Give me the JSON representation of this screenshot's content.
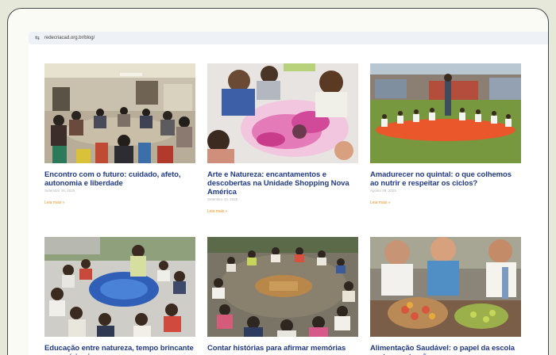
{
  "browser": {
    "url": "redecriacad.org.br/blog/",
    "url_icon": "tune-icon"
  },
  "posts": [
    {
      "title": "Encontro com o futuro: cuidado, afeto, autonomia e liberdade",
      "date": "Setembro 18, 2025",
      "read_more": "Leia mais »",
      "image": "group-meeting-photo"
    },
    {
      "title": "Arte e Natureza: encantamentos e descobertas na Unidade Shopping Nova América",
      "date": "Setembro 10, 2025",
      "read_more": "Leia mais »",
      "image": "children-painting-photo"
    },
    {
      "title": "Amadurecer no quintal: o que colhemos ao nutrir e respeitar os ciclos?",
      "date": "Agosto 28, 2025",
      "read_more": "Leia mais »",
      "image": "children-outdoor-circle-photo"
    },
    {
      "title": "Educação entre natureza, tempo brincante e memória viva",
      "date": "",
      "read_more": "",
      "image": "children-around-blue-cloth-photo"
    },
    {
      "title": "Contar histórias para afirmar memórias",
      "date": "",
      "read_more": "",
      "image": "storytelling-circle-photo"
    },
    {
      "title": "Alimentação Saudável: o papel da escola nesta construção",
      "date": "",
      "read_more": "",
      "image": "children-food-photo"
    }
  ]
}
